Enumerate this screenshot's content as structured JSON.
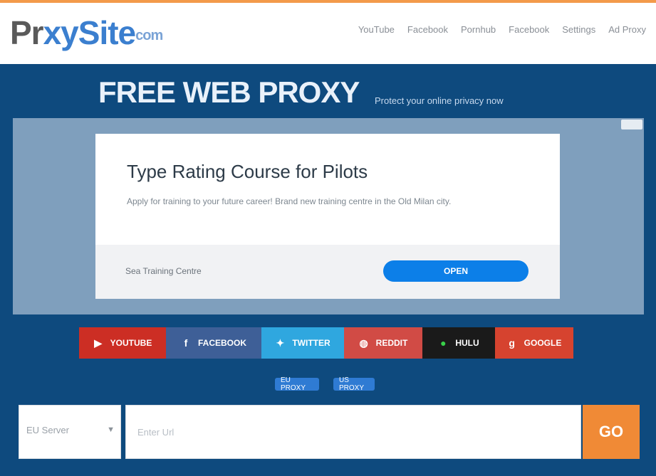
{
  "header": {
    "logo": {
      "part1": "Pr",
      "part2": "xy",
      "part3": "Site",
      "part4": "com"
    },
    "nav": [
      "YouTube",
      "Facebook",
      "Pornhub",
      "Facebook",
      "Settings",
      "Ad Proxy"
    ]
  },
  "hero": {
    "title": "FREE WEB PROXY",
    "subtitle": "Protect your online privacy now"
  },
  "ad": {
    "title": "Type Rating Course for Pilots",
    "description": "Apply for training to your future career! Brand new training centre in the Old Milan city.",
    "sponsor": "Sea Training Centre",
    "open_label": "OPEN"
  },
  "social": [
    {
      "label": "YOUTUBE",
      "icon": "youtube-icon"
    },
    {
      "label": "FACEBOOK",
      "icon": "facebook-icon"
    },
    {
      "label": "TWITTER",
      "icon": "twitter-icon"
    },
    {
      "label": "REDDIT",
      "icon": "reddit-icon"
    },
    {
      "label": "HULU",
      "icon": "hulu-icon"
    },
    {
      "label": "GOOGLE",
      "icon": "google-icon"
    }
  ],
  "pills": [
    "EU PROXY",
    "US PROXY"
  ],
  "search": {
    "server_value": "EU Server",
    "url_placeholder": "Enter Url",
    "go_label": "GO"
  },
  "colors": {
    "accent": "#f08a36",
    "background": "#0e4a7e",
    "ad_button": "#0c7fe8"
  }
}
